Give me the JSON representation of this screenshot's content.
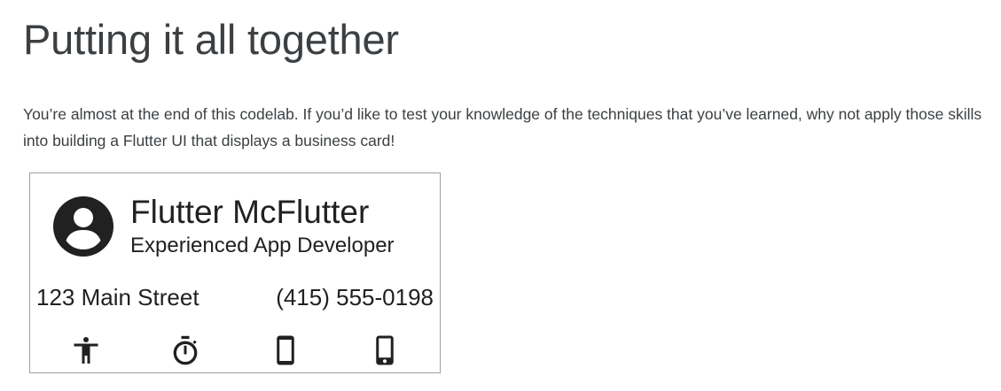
{
  "page": {
    "title": "Putting it all together",
    "intro": "You’re almost at the end of this codelab. If you’d like to test your knowledge of the techniques that you’ve learned, why not apply those skills into building a Flutter UI that displays a business card!"
  },
  "business_card": {
    "name": "Flutter McFlutter",
    "role": "Experienced App Developer",
    "address": "123 Main Street",
    "phone": "(415) 555-0198",
    "avatar_icon": "account-circle-icon",
    "footer_icons": [
      "accessibility-icon",
      "timer-icon",
      "smartphone-icon",
      "phone-android-icon"
    ],
    "colors": {
      "icon": "#212121",
      "border": "#9e9e9e",
      "text": "#212121"
    }
  },
  "colors": {
    "heading_text": "#3c4043",
    "body_text": "#3c4043",
    "background": "#ffffff"
  }
}
